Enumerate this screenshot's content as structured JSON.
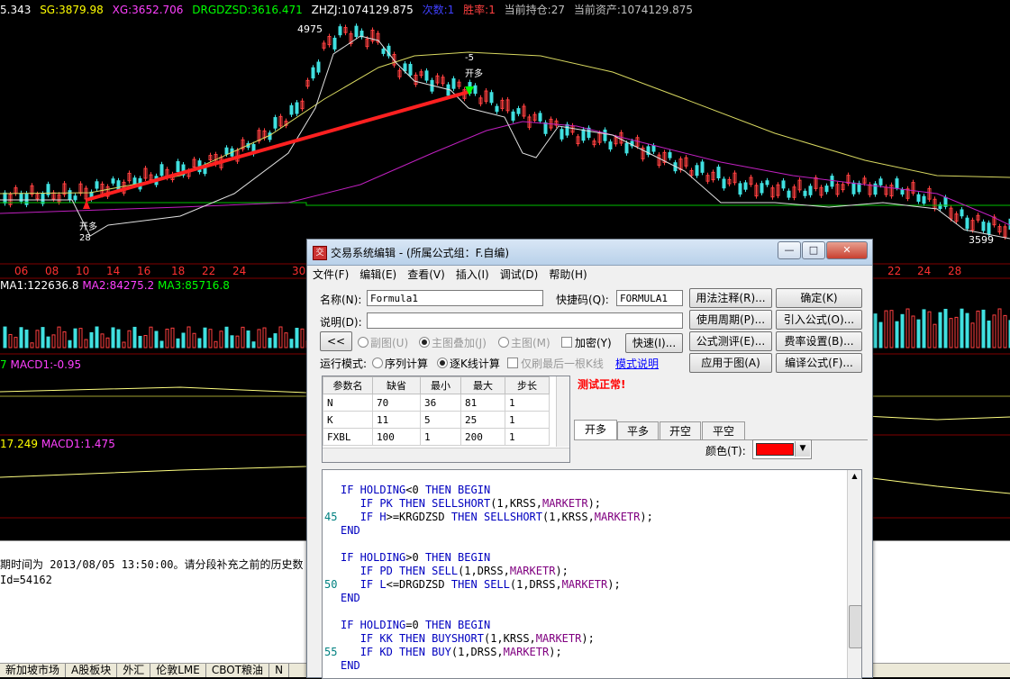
{
  "chart": {
    "top_values": [
      {
        "text": "5.343",
        "color": "#ffffff"
      },
      {
        "text": "SG:3879.98",
        "color": "#ffff00"
      },
      {
        "text": "XG:3652.706",
        "color": "#ff40ff"
      },
      {
        "text": "DRGDZSD:3616.471",
        "color": "#00ff00"
      },
      {
        "text": "ZHZJ:1074129.875",
        "color": "#ffffff"
      },
      {
        "text": "次数:1",
        "color": "#4040ff"
      },
      {
        "text": "胜率:1",
        "color": "#ff4040"
      },
      {
        "text": "当前持仓:27",
        "color": "#c0c0c0"
      },
      {
        "text": "当前资产:1074129.875",
        "color": "#c0c0c0"
      }
    ],
    "high_label": "4975",
    "low_label": "3599",
    "open_long_label": "开多",
    "open_long_qty": "28",
    "open_short_label": "开多",
    "open_short_qty": "-5",
    "date_ticks": [
      "06",
      "08",
      "10",
      "14",
      "16",
      "18",
      "22",
      "24",
      "30",
      "22",
      "24",
      "28"
    ],
    "ma_line": [
      {
        "text": "MA1:122636.8",
        "color": "#ffffff"
      },
      {
        "text": "MA2:84275.2",
        "color": "#ff40ff"
      },
      {
        "text": "MA3:85716.8",
        "color": "#00ff00"
      }
    ],
    "macd_line1": "MACD1:-0.95",
    "macd_prefix1": "7",
    "macd_prefix2": "17.249",
    "macd_line2": "MACD1:1.475"
  },
  "log": {
    "line1": "期时间为 2013/08/05 13:50:00。请分段补充之前的历史数",
    "line2": "Id=54162"
  },
  "tabs": [
    "新加坡市场",
    "A股板块",
    "外汇",
    "伦敦LME",
    "CBOT粮油",
    "N"
  ],
  "dialog": {
    "title": "交易系统编辑 - (所属公式组：F.自编)",
    "menu": [
      "文件(F)",
      "编辑(E)",
      "查看(V)",
      "插入(I)",
      "调试(D)",
      "帮助(H)"
    ],
    "name_label": "名称(N):",
    "name_value": "Formula1",
    "shortcut_label": "快捷码(Q):",
    "shortcut_value": "FORMULA1",
    "desc_label": "说明(D):",
    "desc_value": "",
    "collapse_btn": "<<",
    "opt_subchart": "副图(U)",
    "opt_overlay": "主图叠加(J)",
    "opt_main": "主图(M)",
    "opt_encrypt": "加密(Y)",
    "fast_btn": "快速(I)...",
    "run_mode_label": "运行模式:",
    "run_seq": "序列计算",
    "run_bar": "逐K线计算",
    "run_last": "仅刷最后一根K线",
    "mode_link": "模式说明",
    "status": "测试正常!",
    "buttons": {
      "usage": "用法注释(R)...",
      "ok": "确定(K)",
      "period": "使用周期(P)...",
      "import": "引入公式(O)...",
      "test": "公式测评(E)...",
      "fee": "费率设置(B)...",
      "apply": "应用于图(A)",
      "compile": "编译公式(F)..."
    },
    "param_headers": [
      "参数名",
      "缺省",
      "最小",
      "最大",
      "步长"
    ],
    "params": [
      [
        "N",
        "70",
        "36",
        "81",
        "1"
      ],
      [
        "K",
        "11",
        "5",
        "25",
        "1"
      ],
      [
        "FXBL",
        "100",
        "1",
        "200",
        "1"
      ]
    ],
    "signal_tabs": [
      "开多",
      "平多",
      "开空",
      "平空"
    ],
    "color_label": "颜色(T):",
    "color_value": "#ff0000",
    "code_lines": [
      {
        "ln": "",
        "parts": [
          [
            "kw",
            "IF HOLDING"
          ],
          [
            "t",
            "<0 "
          ],
          [
            "kw",
            "THEN BEGIN"
          ]
        ]
      },
      {
        "ln": "",
        "parts": [
          [
            "t",
            "   "
          ],
          [
            "kw",
            "IF PK THEN SELLSHORT"
          ],
          [
            "t",
            "(1,KRSS,"
          ],
          [
            "fn",
            "MARKETR"
          ],
          [
            "t",
            ");"
          ]
        ]
      },
      {
        "ln": "45",
        "parts": [
          [
            "t",
            "   "
          ],
          [
            "kw",
            "IF H"
          ],
          [
            "t",
            ">=KRGDZSD "
          ],
          [
            "kw",
            "THEN SELLSHORT"
          ],
          [
            "t",
            "(1,KRSS,"
          ],
          [
            "fn",
            "MARKETR"
          ],
          [
            "t",
            ");"
          ]
        ]
      },
      {
        "ln": "",
        "parts": [
          [
            "kw",
            "END"
          ]
        ]
      },
      {
        "ln": "",
        "parts": [
          [
            "t",
            ""
          ]
        ]
      },
      {
        "ln": "",
        "parts": [
          [
            "kw",
            "IF HOLDING"
          ],
          [
            "t",
            ">0 "
          ],
          [
            "kw",
            "THEN BEGIN"
          ]
        ]
      },
      {
        "ln": "",
        "parts": [
          [
            "t",
            "   "
          ],
          [
            "kw",
            "IF PD THEN SELL"
          ],
          [
            "t",
            "(1,DRSS,"
          ],
          [
            "fn",
            "MARKETR"
          ],
          [
            "t",
            ");"
          ]
        ]
      },
      {
        "ln": "50",
        "parts": [
          [
            "t",
            "   "
          ],
          [
            "kw",
            "IF L"
          ],
          [
            "t",
            "<=DRGDZSD "
          ],
          [
            "kw",
            "THEN SELL"
          ],
          [
            "t",
            "(1,DRSS,"
          ],
          [
            "fn",
            "MARKETR"
          ],
          [
            "t",
            ");"
          ]
        ]
      },
      {
        "ln": "",
        "parts": [
          [
            "kw",
            "END"
          ]
        ]
      },
      {
        "ln": "",
        "parts": [
          [
            "t",
            ""
          ]
        ]
      },
      {
        "ln": "",
        "parts": [
          [
            "kw",
            "IF HOLDING"
          ],
          [
            "t",
            "=0 "
          ],
          [
            "kw",
            "THEN BEGIN"
          ]
        ]
      },
      {
        "ln": "",
        "parts": [
          [
            "t",
            "   "
          ],
          [
            "kw",
            "IF KK THEN BUYSHORT"
          ],
          [
            "t",
            "(1,KRSS,"
          ],
          [
            "fn",
            "MARKETR"
          ],
          [
            "t",
            ");"
          ]
        ]
      },
      {
        "ln": "55",
        "parts": [
          [
            "t",
            "   "
          ],
          [
            "kw",
            "IF KD THEN BUY"
          ],
          [
            "t",
            "(1,DRSS,"
          ],
          [
            "fn",
            "MARKETR"
          ],
          [
            "t",
            ");"
          ]
        ]
      },
      {
        "ln": "",
        "parts": [
          [
            "kw",
            "END"
          ]
        ]
      }
    ]
  }
}
